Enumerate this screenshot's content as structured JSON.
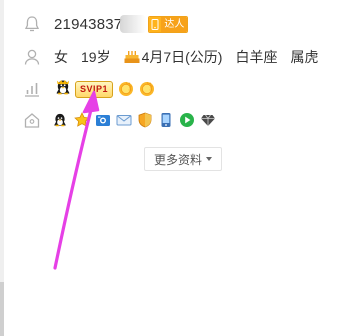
{
  "profile": {
    "qq_number": "21943837",
    "phone_badge_text": "达人",
    "gender": "女",
    "age": "19岁",
    "birthday": "4月7日(公历)",
    "zodiac": "白羊座",
    "chinese_zodiac": "属虎",
    "vip_label": "SVIP1",
    "level_icons": [
      "sun-icon",
      "sun-icon"
    ],
    "services": [
      "qq-penguin-icon",
      "star-icon",
      "photo-icon",
      "mail-icon",
      "shield-icon",
      "phone-icon",
      "video-play-icon",
      "diamond-icon"
    ],
    "more_button_label": "更多资料"
  },
  "colors": {
    "annotation_arrow": "#e640e6",
    "badge_orange": "#f7a21a",
    "vip_red": "#c2180f"
  }
}
